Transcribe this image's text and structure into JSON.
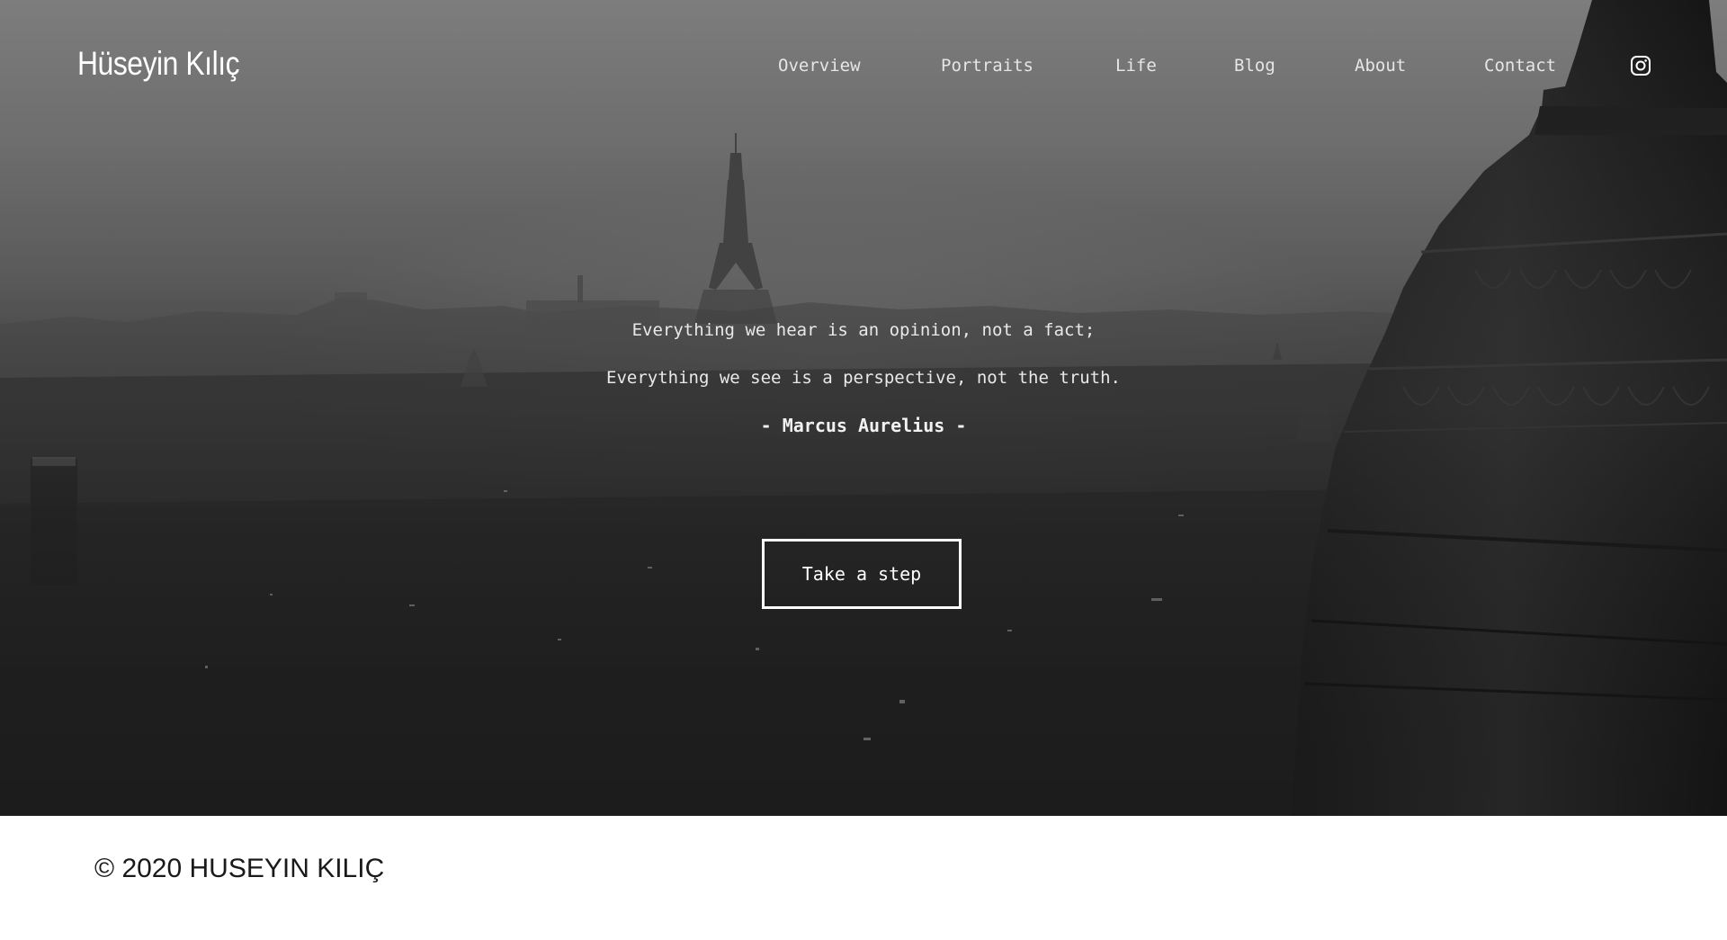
{
  "header": {
    "brand": "Hüseyin Kılıç",
    "nav": [
      {
        "label": "Overview"
      },
      {
        "label": "Portraits"
      },
      {
        "label": "Life"
      },
      {
        "label": "Blog"
      },
      {
        "label": "About"
      },
      {
        "label": "Contact"
      }
    ],
    "social_icon": "instagram-icon"
  },
  "hero": {
    "quote_line_1": "Everything we hear is an opinion, not a fact;",
    "quote_line_2": "Everything we see is a perspective, not the truth.",
    "author": "- Marcus Aurelius -",
    "cta_label": "Take a step"
  },
  "footer": {
    "copyright": "© 2020 HUSEYIN KILIÇ"
  },
  "colors": {
    "hero_top": "#7d7d7d",
    "hero_bottom": "#181818",
    "text": "#ffffff",
    "footer_bg": "#ffffff",
    "footer_text": "#1a1a1a"
  }
}
